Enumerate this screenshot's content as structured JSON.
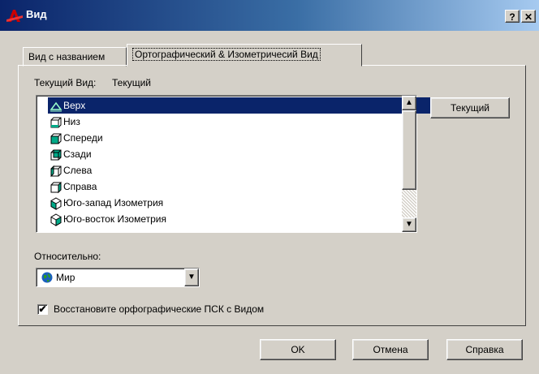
{
  "window": {
    "title": "Вид",
    "help_btn": "?",
    "close_btn": "✕"
  },
  "tabs": [
    {
      "label": "Вид с названием"
    },
    {
      "label": "Ортографический & Изометричесий Вид"
    }
  ],
  "current_view": {
    "label": "Текущий Вид:",
    "value": "Текущий"
  },
  "views": [
    {
      "label": "Верх",
      "icon": "top-view-icon",
      "selected": true
    },
    {
      "label": "Низ",
      "icon": "bottom-view-icon"
    },
    {
      "label": "Спереди",
      "icon": "front-view-icon"
    },
    {
      "label": "Сзади",
      "icon": "back-view-icon"
    },
    {
      "label": "Слева",
      "icon": "left-view-icon"
    },
    {
      "label": "Справа",
      "icon": "right-view-icon"
    },
    {
      "label": "Юго-запад Изометрия",
      "icon": "sw-iso-icon"
    },
    {
      "label": "Юго-восток Изометрия",
      "icon": "se-iso-icon"
    }
  ],
  "set_current_button": "Текущий",
  "relative": {
    "label": "Относительно:",
    "value": "Мир",
    "icon": "globe-icon"
  },
  "restore_ucs": {
    "label": "Восстановите орфографические ПСК с Видом",
    "checked": true
  },
  "footer": {
    "ok": "OK",
    "cancel": "Отмена",
    "help": "Справка"
  },
  "colors": {
    "selection": "#0a246a",
    "face": "#d4d0c8",
    "title_start": "#0a246a",
    "title_end": "#a6caf0"
  }
}
